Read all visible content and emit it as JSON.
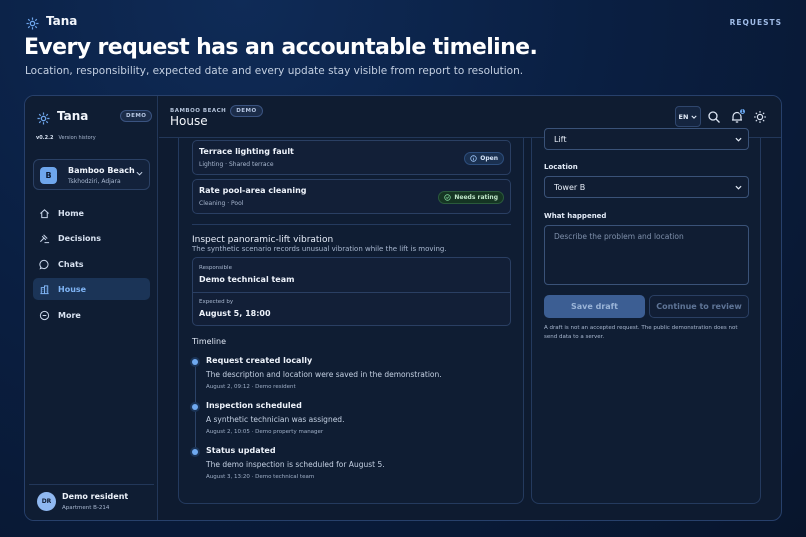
{
  "site": {
    "brand": "Tana",
    "nav_link": "REQUESTS",
    "headline": "Every request has an accountable timeline.",
    "subheadline": "Location, responsibility, expected date and every update stay visible from report to resolution."
  },
  "sidebar": {
    "brand": "Tana",
    "demo_badge": "DEMO",
    "version": "v0.2.2",
    "version_link": "Version history",
    "property": {
      "initial": "B",
      "name": "Bamboo Beach",
      "location": "Tskhodziri, Adjara"
    },
    "items": [
      {
        "label": "Home",
        "icon": "home-icon"
      },
      {
        "label": "Decisions",
        "icon": "gavel-icon"
      },
      {
        "label": "Chats",
        "icon": "chat-icon"
      },
      {
        "label": "House",
        "icon": "building-icon",
        "active": true
      },
      {
        "label": "More",
        "icon": "more-icon"
      }
    ],
    "user": {
      "initials": "DR",
      "name": "Demo resident",
      "unit": "Apartment B-214"
    }
  },
  "header": {
    "breadcrumb": "BAMBOO BEACH",
    "demo_badge": "DEMO",
    "title": "House",
    "lang": "EN",
    "notification_count": "1"
  },
  "requests": [
    {
      "title": "Terrace lighting fault",
      "meta": "Lighting · Shared terrace",
      "status": "Open"
    },
    {
      "title": "Rate pool-area cleaning",
      "meta": "Cleaning · Pool",
      "status": "Needs rating"
    }
  ],
  "detail": {
    "title": "Inspect panoramic-lift vibration",
    "description": "The synthetic scenario records unusual vibration while the lift is moving.",
    "responsible_label": "Responsible",
    "responsible": "Demo technical team",
    "expected_label": "Expected by",
    "expected": "August 5, 18:00"
  },
  "timeline": {
    "heading": "Timeline",
    "events": [
      {
        "title": "Request created locally",
        "text": "The description and location were saved in the demonstration.",
        "meta": "August 2, 09:12 · Demo resident"
      },
      {
        "title": "Inspection scheduled",
        "text": "A synthetic technician was assigned.",
        "meta": "August 2, 10:05 · Demo property manager"
      },
      {
        "title": "Status updated",
        "text": "The demo inspection is scheduled for August 5.",
        "meta": "August 3, 13:20 · Demo technical team"
      }
    ]
  },
  "form": {
    "category_value": "Lift",
    "location_label": "Location",
    "location_value": "Tower B",
    "what_label": "What happened",
    "what_placeholder": "Describe the problem and location",
    "save_label": "Save draft",
    "continue_label": "Continue to review",
    "note": "A draft is not an accepted request. The public demonstration does not send data to a server."
  },
  "colors": {
    "accent": "#6ea6ec",
    "background": "#0a1f42",
    "panel": "#0f1d33"
  }
}
